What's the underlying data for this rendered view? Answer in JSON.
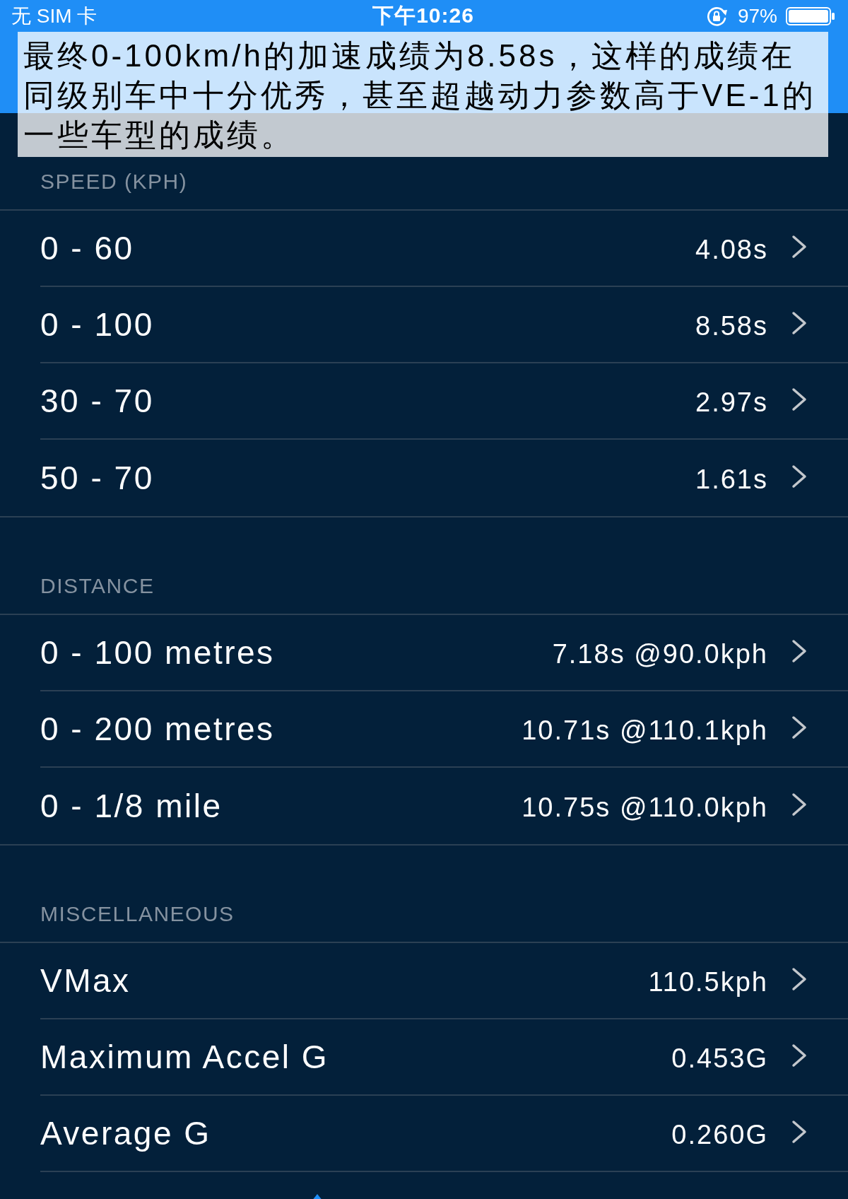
{
  "status_bar": {
    "carrier": "无 SIM 卡",
    "time": "下午10:26",
    "battery": "97%"
  },
  "caption": {
    "lines": [
      "最终0-100km/h的加速成绩为8.58s，这样的成绩在",
      "同级别车中十分优秀，甚至超越动力参数高于VE-1的",
      "一些车型的成绩。"
    ]
  },
  "sections": [
    {
      "header": "SPEED (KPH)",
      "rows": [
        {
          "kind": "timing",
          "label": "0 - 60",
          "value": "4.08s"
        },
        {
          "kind": "timing",
          "label": "0 - 100",
          "value": "8.58s"
        },
        {
          "kind": "timing",
          "label": "30 - 70",
          "value": "2.97s"
        },
        {
          "kind": "timing",
          "label": "50 - 70",
          "value": "1.61s"
        }
      ]
    },
    {
      "header": "DISTANCE",
      "rows": [
        {
          "kind": "timing",
          "label": "0 - 100 metres",
          "value": "7.18s @90.0kph"
        },
        {
          "kind": "timing",
          "label": "0 - 200 metres",
          "value": "10.71s @110.1kph"
        },
        {
          "kind": "timing",
          "label": "0 - 1/8 mile",
          "value": "10.75s @110.0kph"
        }
      ]
    },
    {
      "header": "MISCELLANEOUS",
      "rows": [
        {
          "kind": "timing",
          "label": "VMax",
          "value": "110.5kph"
        },
        {
          "kind": "timing",
          "label": "Maximum Accel G",
          "value": "0.453G"
        },
        {
          "kind": "timing",
          "label": "Average G",
          "value": "0.260G"
        },
        {
          "kind": "cut_off"
        }
      ]
    }
  ]
}
